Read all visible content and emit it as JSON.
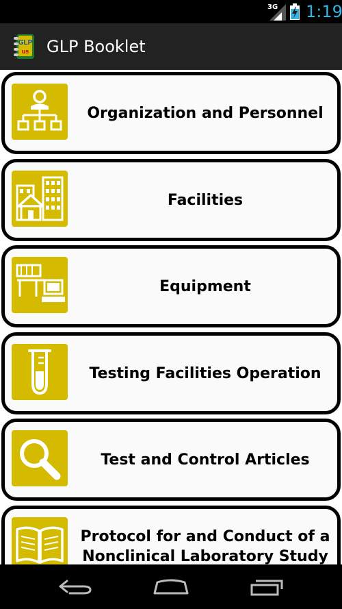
{
  "status_bar": {
    "network": "3G",
    "time": "1:19",
    "clock_color": "#33b5e5"
  },
  "action_bar": {
    "app_icon_text_top": "GLP",
    "app_icon_text_bottom": "us",
    "title": "GLP Booklet"
  },
  "menu": {
    "icon_color": "#d4bb00",
    "items": [
      {
        "label": "Organization and Personnel",
        "icon": "org-chart-icon"
      },
      {
        "label": "Facilities",
        "icon": "buildings-icon"
      },
      {
        "label": "Equipment",
        "icon": "lab-equipment-icon"
      },
      {
        "label": "Testing Facilities Operation",
        "icon": "test-tube-icon"
      },
      {
        "label": "Test and Control Articles",
        "icon": "magnifier-icon"
      },
      {
        "label": "Protocol for and Conduct of a Nonclinical Laboratory Study",
        "icon": "open-book-icon"
      }
    ]
  },
  "nav_bar": {
    "buttons": [
      "back",
      "home",
      "recent-apps"
    ]
  }
}
